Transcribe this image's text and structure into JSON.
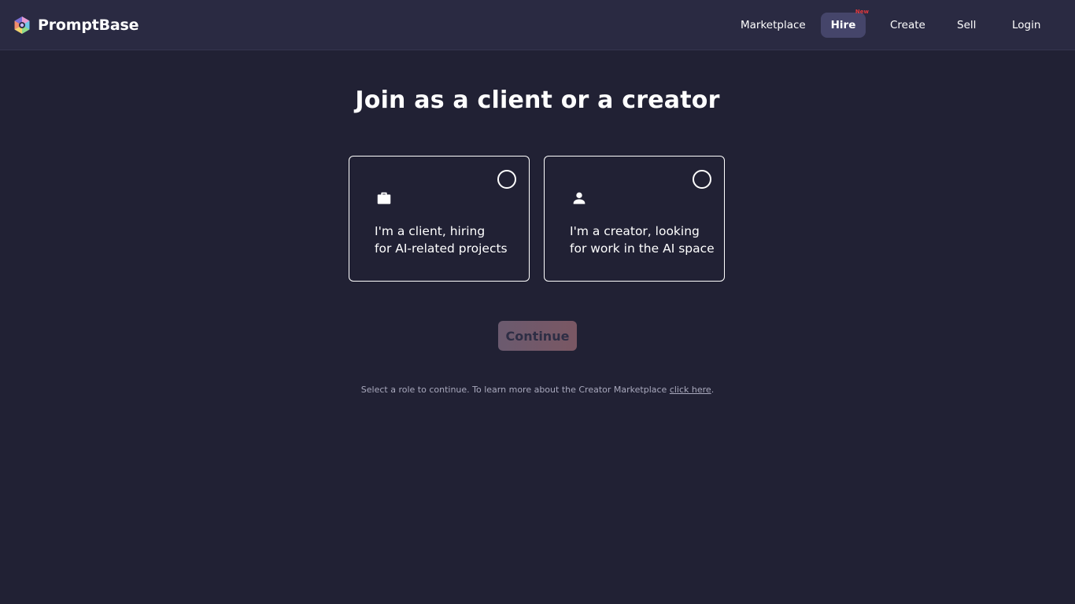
{
  "header": {
    "brand_name": "PromptBase",
    "nav": {
      "marketplace": "Marketplace",
      "hire": "Hire",
      "hire_badge": "New",
      "create": "Create",
      "sell": "Sell",
      "login": "Login"
    }
  },
  "main": {
    "title": "Join as a client or a creator",
    "roles": [
      {
        "icon": "briefcase-icon",
        "line1": "I'm a client, hiring",
        "line2": "for AI-related projects",
        "selected": false
      },
      {
        "icon": "person-icon",
        "line1": "I'm a creator, looking",
        "line2": "for work in the AI space",
        "selected": false
      }
    ],
    "continue_label": "Continue",
    "continue_enabled": false,
    "helper_text": "Select a role to continue. To learn more about the Creator Marketplace ",
    "helper_link": "click here",
    "helper_end": "."
  },
  "colors": {
    "background": "#212134",
    "navbar": "#2a2a42",
    "nav_active": "#45456a",
    "badge": "#e0393e",
    "button_gradient_start": "#6b5a6f",
    "button_gradient_end": "#7a5763"
  }
}
